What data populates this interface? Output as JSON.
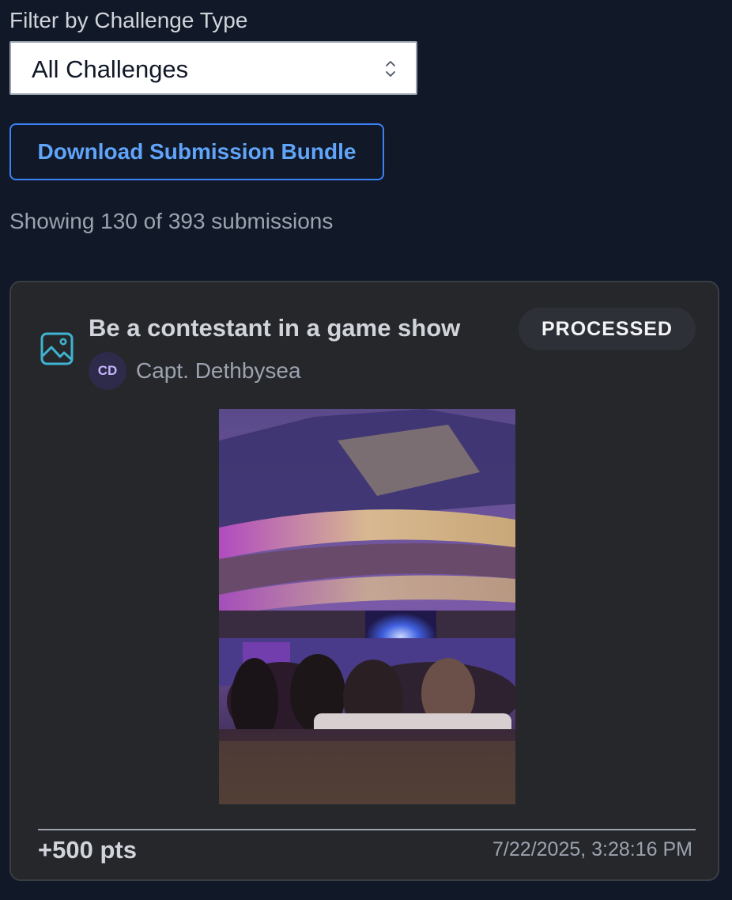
{
  "filter": {
    "label": "Filter by Challenge Type",
    "selected": "All Challenges"
  },
  "download_button": {
    "label": "Download Submission Bundle"
  },
  "results": {
    "count_text": "Showing 130 of 393 submissions"
  },
  "submission": {
    "type_icon": "image-icon",
    "title": "Be a contestant in a game show",
    "status": "PROCESSED",
    "author": {
      "initials": "CD",
      "name": "Capt. Dethbysea"
    },
    "points": "+500 pts",
    "timestamp": "7/22/2025, 3:28:16 PM"
  },
  "colors": {
    "page_background": "#111827",
    "card_background": "#25272b",
    "accent_blue": "#3b82f6",
    "icon_teal": "#38bdf8",
    "avatar_background": "#2e2a4a"
  }
}
